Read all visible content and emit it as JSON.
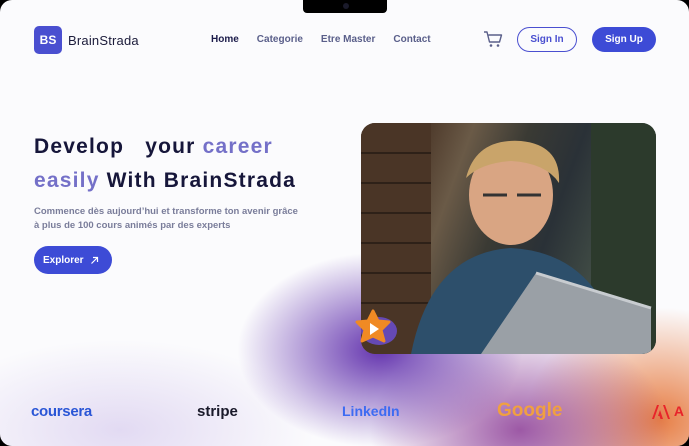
{
  "header": {
    "logo_badge": "BS",
    "logo_text": "BrainStrada",
    "nav": [
      "Home",
      "Categorie",
      "Etre Master",
      "Contact"
    ],
    "sign_in": "Sign In",
    "sign_up": "Sign Up"
  },
  "hero": {
    "line1_word1": "Develop",
    "line1_word2": "your",
    "line1_word3": "career",
    "line2_word1": "easily",
    "line2_rest": "With BrainStrada",
    "subtitle_line1": "Commence dès aujourd’hui et transforme ton avenir grâce",
    "subtitle_line2": "à plus de 100 cours animés par des experts",
    "cta": "Explorer"
  },
  "partners": [
    "coursera",
    "stripe",
    "LinkedIn",
    "Google",
    "A"
  ],
  "colors": {
    "primary": "#3d4bd6",
    "accent": "#6a63c8",
    "play": "#f08a24"
  }
}
